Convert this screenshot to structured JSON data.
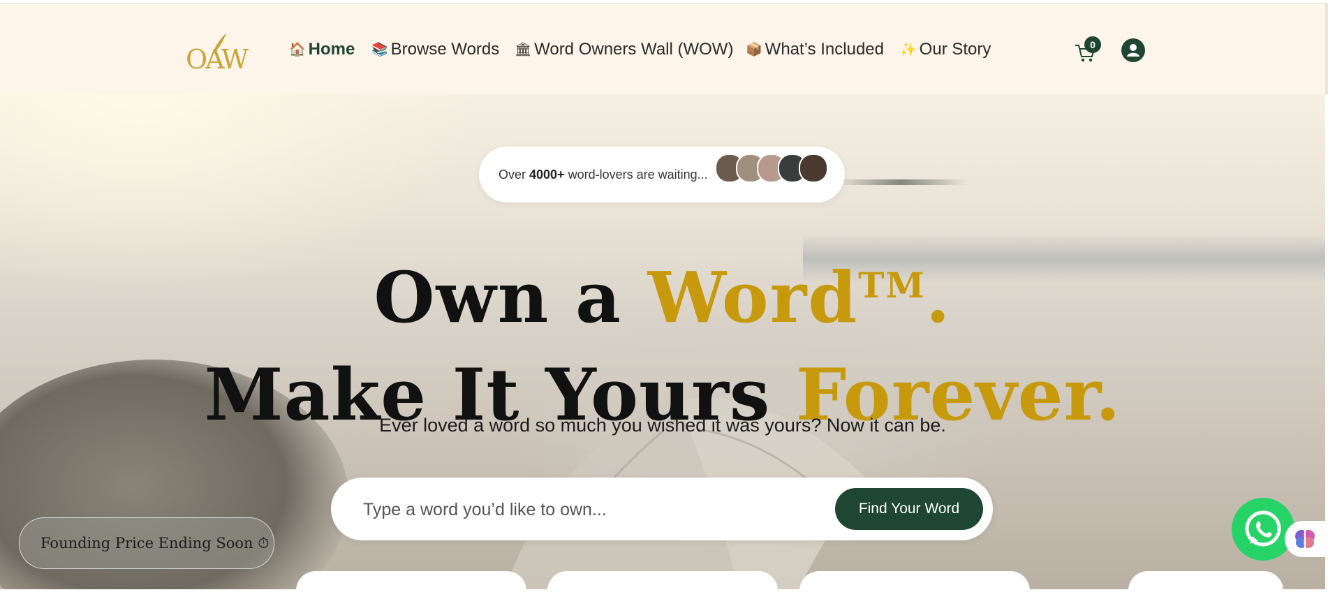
{
  "brand": {
    "logo_text": "OAW",
    "logo_color": "#c9a43a"
  },
  "nav": {
    "items": [
      {
        "icon": "🏠",
        "label": "Home",
        "active": true
      },
      {
        "icon": "📚",
        "label": "Browse Words",
        "active": false
      },
      {
        "icon": "🏛",
        "label": "Word Owners Wall (WOW)",
        "active": false
      },
      {
        "icon": "📦",
        "label": "What’s Included",
        "active": false
      },
      {
        "icon": "✨",
        "label": "Our Story",
        "active": false
      }
    ],
    "cart_count": "0"
  },
  "hero": {
    "waitlist": {
      "prefix": "Over ",
      "count": "4000+",
      "suffix": " word-lovers are waiting..."
    },
    "headline_line1_dark": "Own a ",
    "headline_line1_gold": "Word",
    "headline_tm": "TM",
    "headline_line1_dot": ".",
    "headline_line2_dark": "Make It Yours ",
    "headline_line2_gold": "Forever.",
    "subheading": "Ever loved a word so much you wished it was yours? Now it can be.",
    "search": {
      "placeholder": "Type a word you’d like to own...",
      "button_label": "Find Your Word"
    }
  },
  "promo": {
    "label": "Founding Price Ending Soon ⏱"
  },
  "colors": {
    "primary": "#1f4533",
    "gold": "#c79a0d",
    "nav_bg": "#fdf5e9",
    "whatsapp": "#25d366"
  }
}
